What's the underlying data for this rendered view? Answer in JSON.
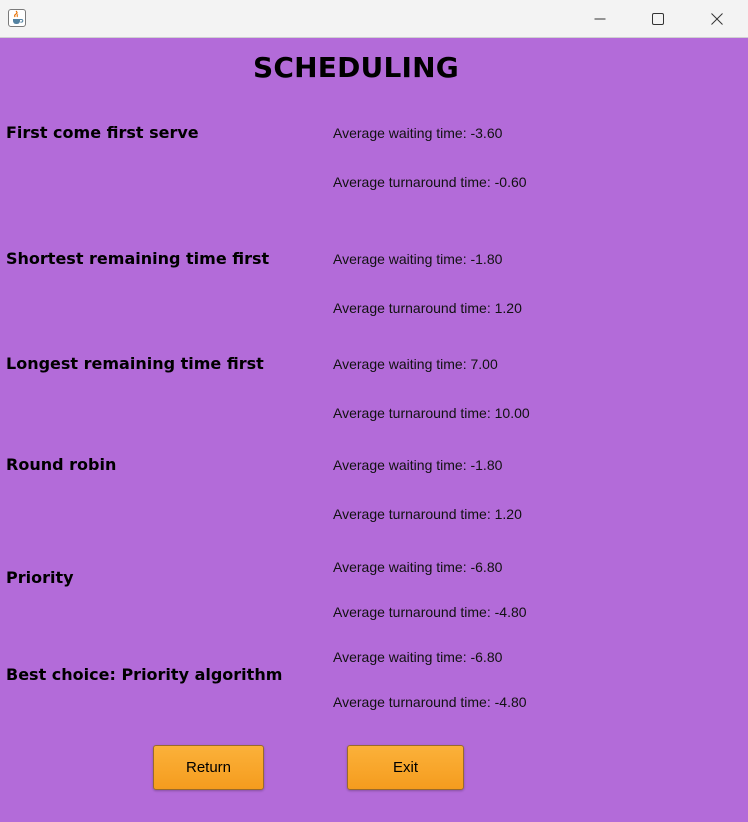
{
  "window": {
    "app_icon": "java-coffee-cup-icon",
    "controls": [
      "minimize-icon",
      "maximize-icon",
      "close-icon"
    ]
  },
  "heading": "SCHEDULING",
  "algorithms": [
    {
      "name": "First come first serve",
      "waiting": "Average waiting time: -3.60",
      "turnaround": "Average turnaround time: -0.60"
    },
    {
      "name": "Shortest remaining time first",
      "waiting": "Average waiting time: -1.80",
      "turnaround": "Average turnaround time: 1.20"
    },
    {
      "name": "Longest remaining time first",
      "waiting": "Average waiting time: 7.00",
      "turnaround": "Average turnaround time: 10.00"
    },
    {
      "name": "Round robin",
      "waiting": "Average waiting time: -1.80",
      "turnaround": "Average turnaround time: 1.20"
    },
    {
      "name": "Priority",
      "waiting": "Average waiting time: -6.80",
      "turnaround": "Average turnaround time: -4.80"
    }
  ],
  "best": {
    "label": "Best choice: Priority algorithm",
    "waiting": "Average waiting time: -6.80",
    "turnaround": "Average turnaround time: -4.80"
  },
  "buttons": {
    "return_label": "Return",
    "exit_label": "Exit"
  },
  "colors": {
    "background": "#b36bd9",
    "button": "#f8a42a",
    "titlebar": "#f3f3f3"
  }
}
